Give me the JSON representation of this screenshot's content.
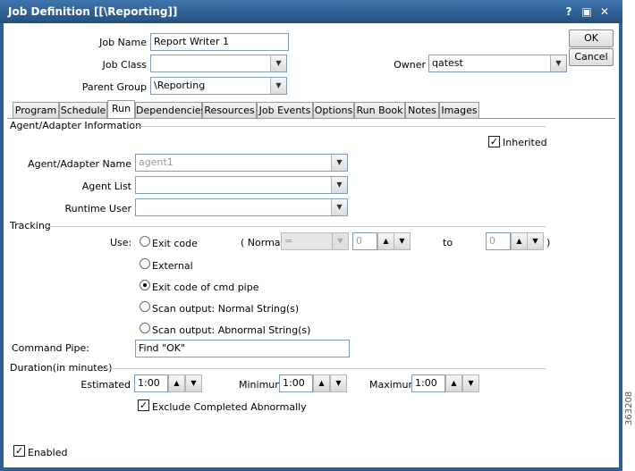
{
  "window": {
    "title": "Job Definition [[\\Reporting]]",
    "help": "?",
    "restore": "▣",
    "close": "✕"
  },
  "header": {
    "job_name_label": "Job Name",
    "job_name": "Report Writer 1",
    "job_class_label": "Job Class",
    "job_class": "",
    "parent_group_label": "Parent Group",
    "parent_group": "\\Reporting",
    "owner_label": "Owner",
    "owner": "qatest"
  },
  "buttons": {
    "ok": "OK",
    "cancel": "Cancel"
  },
  "tabs": [
    "Program",
    "Schedule",
    "Run",
    "Dependencies",
    "Resources",
    "Job Events",
    "Options",
    "Run Book",
    "Notes",
    "Images"
  ],
  "active_tab": "Run",
  "agent": {
    "section": "Agent/Adapter Information",
    "inherited_label": "Inherited",
    "name_label": "Agent/Adapter Name",
    "name_value": "agent1",
    "list_label": "Agent List",
    "list_value": "",
    "runtime_label": "Runtime User",
    "runtime_value": ""
  },
  "tracking": {
    "section": "Tracking",
    "use_label": "Use:",
    "options": [
      "Exit code",
      "External",
      "Exit code of cmd pipe",
      "Scan output: Normal String(s)",
      "Scan output: Abnormal String(s)"
    ],
    "selected": "Exit code of cmd pipe",
    "normal_label": "( Normal",
    "operator": "=",
    "from_value": "0",
    "to_label": "to",
    "to_value": "0",
    "close_paren": ")"
  },
  "command_pipe": {
    "label": "Command Pipe:",
    "value": "Find \"OK\""
  },
  "duration": {
    "section": "Duration(in minutes)",
    "estimated_label": "Estimated",
    "estimated": "1:00",
    "minimum_label": "Minimum",
    "minimum": "1:00",
    "maximum_label": "Maximum",
    "maximum": "1:00",
    "exclude_label": "Exclude Completed Abnormally"
  },
  "enabled_label": "Enabled",
  "figure_id": "363208",
  "glyphs": {
    "check": "✓",
    "down": "▼",
    "up": "▲"
  }
}
